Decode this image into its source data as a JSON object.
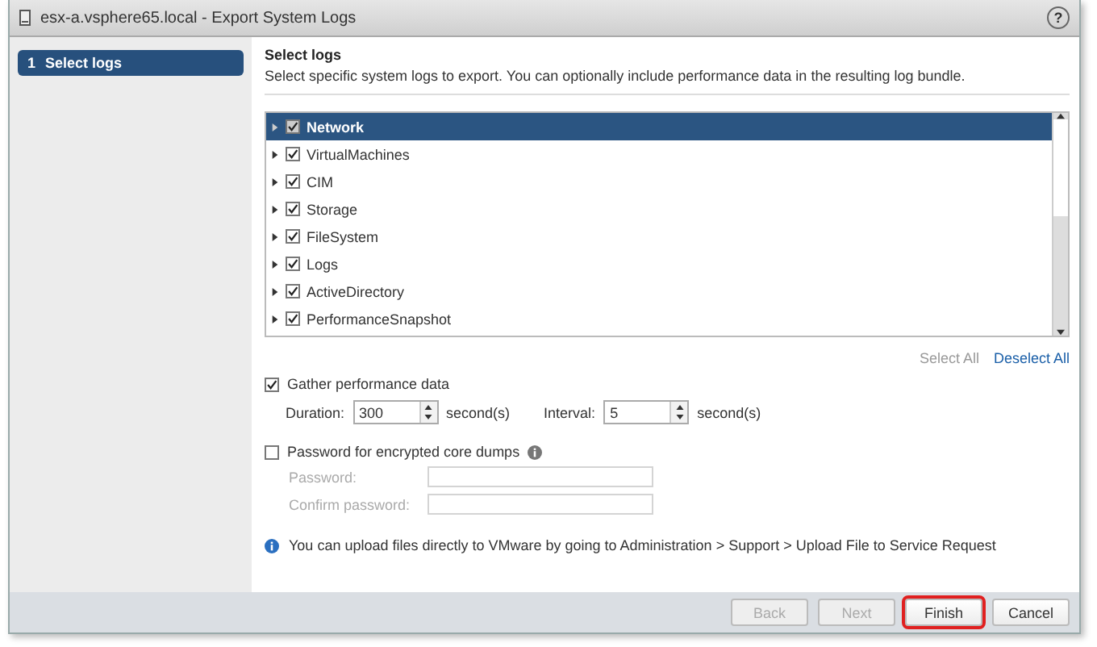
{
  "window": {
    "title": "esx-a.vsphere65.local - Export System Logs",
    "help": "?"
  },
  "steps": [
    {
      "number": "1",
      "label": "Select logs",
      "selected": true
    }
  ],
  "page": {
    "heading": "Select logs",
    "description": "Select specific system logs to export. You can optionally include performance data in the resulting log bundle."
  },
  "log_tree": [
    {
      "label": "Network",
      "checked": true,
      "selected": true,
      "expanded": false
    },
    {
      "label": "VirtualMachines",
      "checked": true,
      "selected": false,
      "expanded": false
    },
    {
      "label": "CIM",
      "checked": true,
      "selected": false,
      "expanded": false
    },
    {
      "label": "Storage",
      "checked": true,
      "selected": false,
      "expanded": false
    },
    {
      "label": "FileSystem",
      "checked": true,
      "selected": false,
      "expanded": false
    },
    {
      "label": "Logs",
      "checked": true,
      "selected": false,
      "expanded": false
    },
    {
      "label": "ActiveDirectory",
      "checked": true,
      "selected": false,
      "expanded": false
    },
    {
      "label": "PerformanceSnapshot",
      "checked": true,
      "selected": false,
      "expanded": false
    }
  ],
  "links": [
    {
      "label": "Select All",
      "disabled": true
    },
    {
      "label": "Deselect All",
      "disabled": false
    }
  ],
  "performance": {
    "label": "Gather performance data",
    "checked": true,
    "spinners": [
      {
        "label": "Duration:",
        "value": "300",
        "unit": "second(s)"
      },
      {
        "label": "Interval:",
        "value": "5",
        "unit": "second(s)"
      }
    ]
  },
  "encryption": {
    "label": "Password for encrypted core dumps",
    "checked": false,
    "fields": [
      {
        "label": "Password:",
        "disabled": true
      },
      {
        "label": "Confirm password:",
        "disabled": true
      }
    ]
  },
  "info": "You can upload files directly to VMware by going to Administration > Support > Upload File to Service Request",
  "buttons": [
    {
      "label": "Back",
      "disabled": true,
      "highlighted": false
    },
    {
      "label": "Next",
      "disabled": true,
      "highlighted": false
    },
    {
      "label": "Finish",
      "disabled": false,
      "highlighted": true
    },
    {
      "label": "Cancel",
      "disabled": false,
      "highlighted": false
    }
  ]
}
